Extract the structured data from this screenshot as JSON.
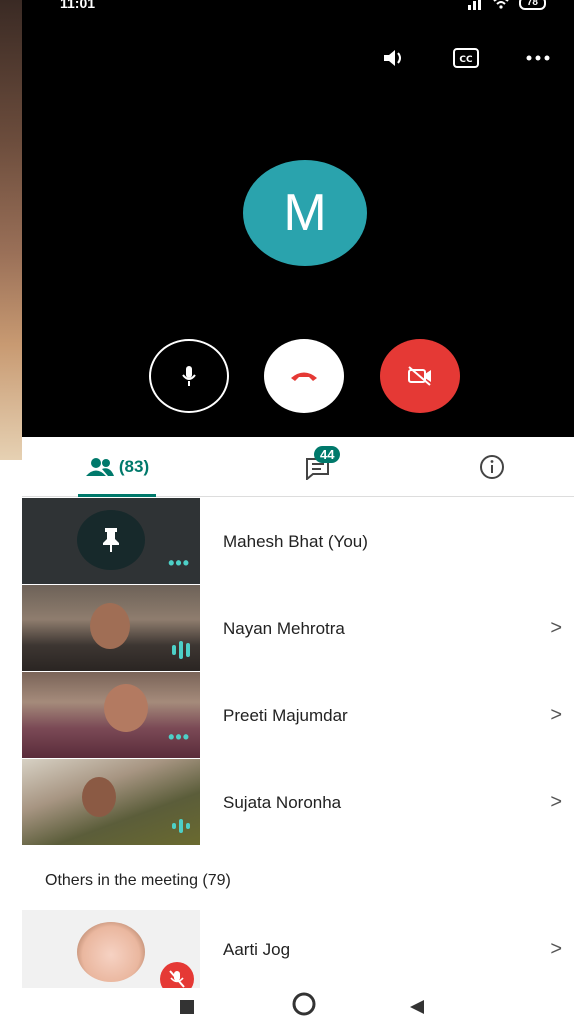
{
  "status": {
    "time": "11:01",
    "battery": "78"
  },
  "call": {
    "avatar_initial": "M",
    "top_icons": [
      "speaker-icon",
      "captions-icon",
      "more-icon"
    ],
    "controls": [
      "mic-icon",
      "end-call-icon",
      "camera-off-icon"
    ]
  },
  "tabs": {
    "people_count": "(83)",
    "chat_badge": "44",
    "info": "info-icon"
  },
  "participants": [
    {
      "name": "Mahesh Bhat (You)"
    },
    {
      "name": "Nayan Mehrotra"
    },
    {
      "name": "Preeti Majumdar"
    },
    {
      "name": "Sujata Noronha"
    }
  ],
  "others": {
    "heading": "Others in the meeting (79)",
    "items": [
      {
        "name": "Aarti Jog"
      }
    ]
  },
  "colors": {
    "accent": "#00796b",
    "teal_avatar": "#2aa3ad",
    "end_red": "#e53935"
  }
}
